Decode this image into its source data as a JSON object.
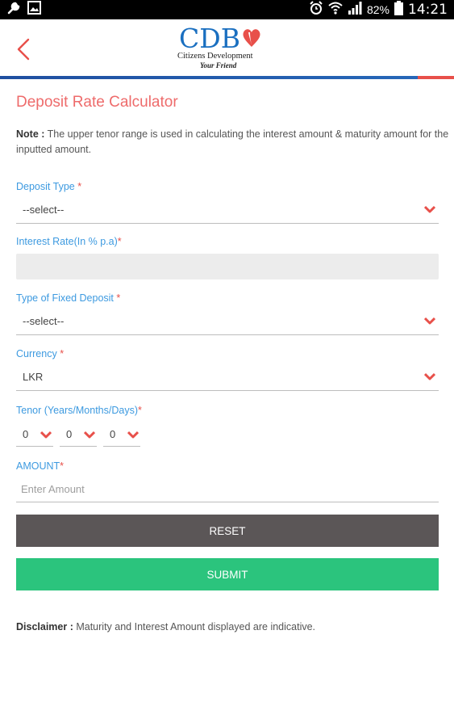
{
  "status_bar": {
    "battery_percent": "82%",
    "time": "14:21"
  },
  "app_bar": {
    "logo_text": "CDB",
    "logo_subtitle": "Citizens Development",
    "logo_tagline": "Your Friend"
  },
  "page": {
    "title": "Deposit Rate Calculator",
    "note_label": "Note :",
    "note_text": " The upper tenor range is used in calculating the interest amount & maturity amount for the inputted amount."
  },
  "form": {
    "deposit_type": {
      "label": "Deposit Type ",
      "required": "*",
      "value": "--select--"
    },
    "interest_rate": {
      "label": "Interest Rate(In % p.a)",
      "required": "*",
      "value": ""
    },
    "fixed_deposit_type": {
      "label": "Type of Fixed Deposit ",
      "required": "*",
      "value": "--select--"
    },
    "currency": {
      "label": "Currency ",
      "required": "*",
      "value": "LKR"
    },
    "tenor": {
      "label": "Tenor (Years/Months/Days)",
      "required": "*",
      "years": "0",
      "months": "0",
      "days": "0"
    },
    "amount": {
      "label": "AMOUNT",
      "required": "*",
      "placeholder": "Enter Amount"
    }
  },
  "buttons": {
    "reset": "RESET",
    "submit": "SUBMIT"
  },
  "disclaimer": {
    "label": "Disclaimer :",
    "text": " Maturity and Interest Amount displayed are indicative."
  },
  "colors": {
    "accent_red": "#ee6b6b",
    "label_blue": "#3d9ae0",
    "reset_grey": "#5b5657",
    "submit_green": "#2bc47d",
    "brand_blue": "#1a6fc0"
  },
  "icons": {
    "wrench": "wrench-icon",
    "image": "image-icon",
    "alarm": "alarm-icon",
    "wifi": "wifi-icon",
    "signal": "signal-icon",
    "battery": "battery-icon",
    "back": "back-arrow-icon",
    "chevron": "chevron-down-icon"
  }
}
